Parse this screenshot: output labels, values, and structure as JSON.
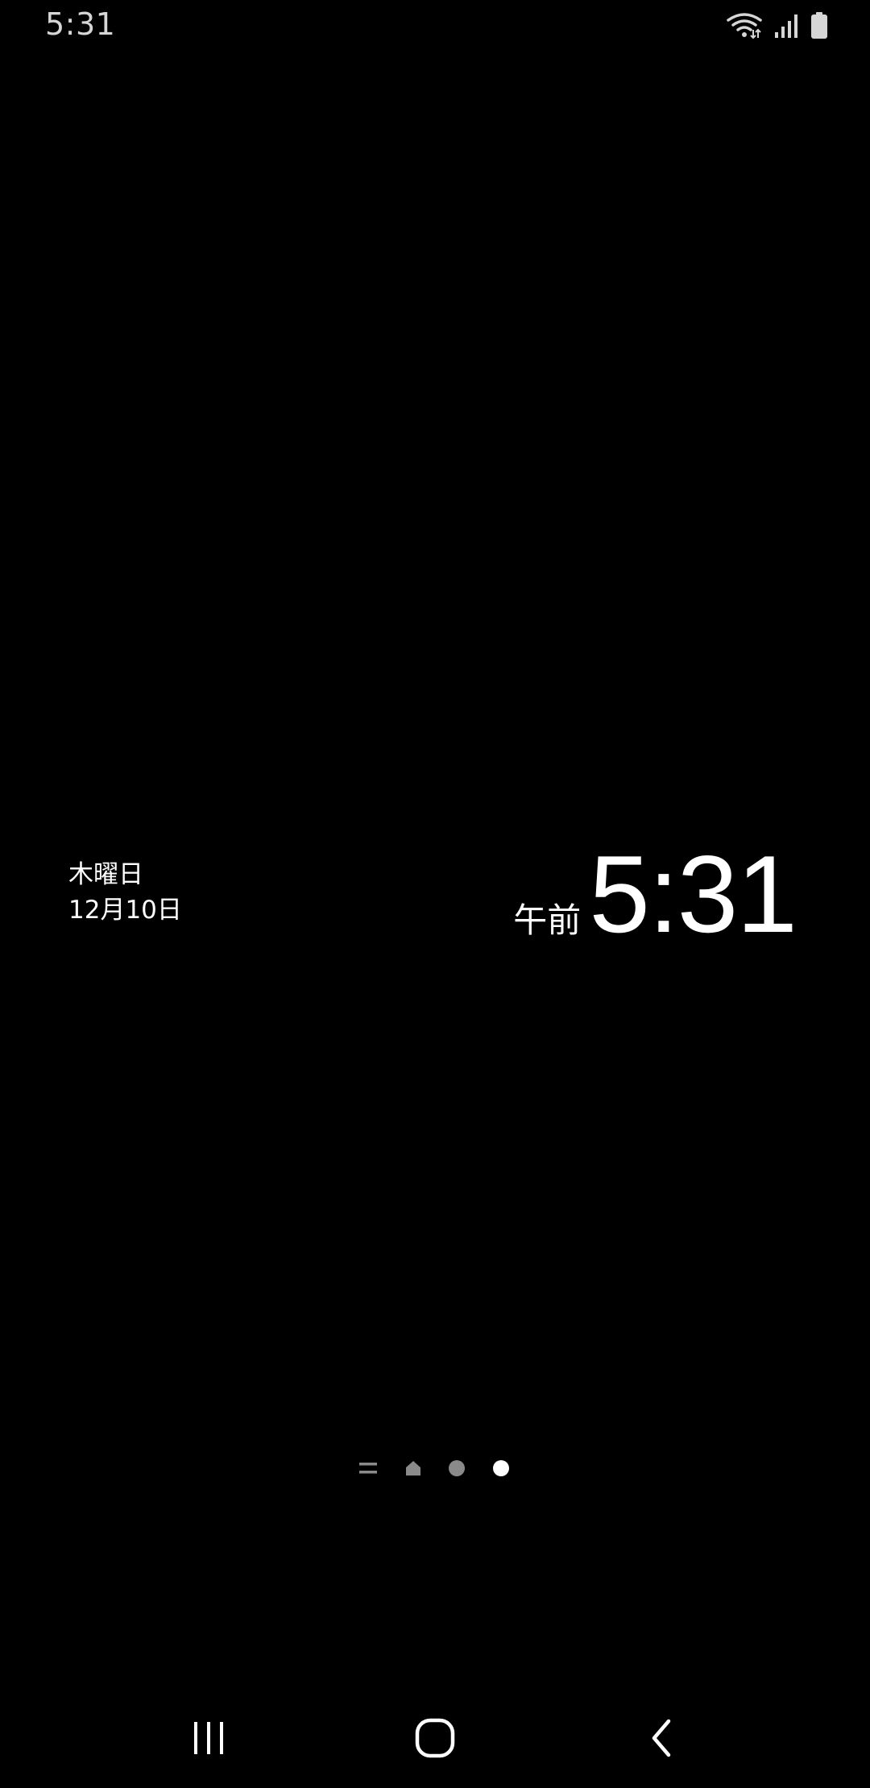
{
  "status_bar": {
    "time": "5:31",
    "icons": [
      "wifi-icon",
      "signal-icon",
      "battery-icon"
    ]
  },
  "widget": {
    "weekday": "木曜日",
    "date": "12月10日",
    "ampm": "午前",
    "time": "5:31"
  },
  "page_indicator": {
    "items": [
      "menu-page-indicator-icon",
      "home-page-indicator-icon",
      "page-dot",
      "page-dot"
    ],
    "active_index": 3
  },
  "nav_bar": {
    "buttons": [
      "recent-apps-icon",
      "home-icon",
      "back-icon"
    ]
  },
  "colors": {
    "background": "#000000",
    "text": "#ffffff",
    "status_text": "#d6d6d6",
    "inactive_indicator": "#8a8a8a"
  }
}
